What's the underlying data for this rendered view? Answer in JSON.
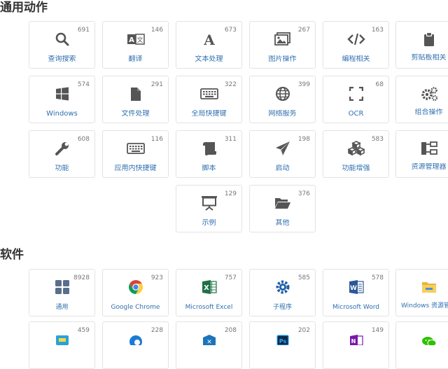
{
  "sections": [
    {
      "title": "通用动作",
      "cards": [
        {
          "label": "查询搜索",
          "count": "691",
          "icon": "search-icon"
        },
        {
          "label": "翻译",
          "count": "146",
          "icon": "translate-icon"
        },
        {
          "label": "文本处理",
          "count": "673",
          "icon": "font-icon"
        },
        {
          "label": "图片操作",
          "count": "267",
          "icon": "images-icon"
        },
        {
          "label": "编程相关",
          "count": "163",
          "icon": "code-icon"
        },
        {
          "label": "剪贴板相关",
          "count": "",
          "icon": "clipboard-icon"
        },
        {
          "label": "Windows",
          "count": "574",
          "icon": "windows-icon"
        },
        {
          "label": "文件处理",
          "count": "291",
          "icon": "file-icon"
        },
        {
          "label": "全局快捷键",
          "count": "322",
          "icon": "keyboard-icon"
        },
        {
          "label": "网络服务",
          "count": "399",
          "icon": "globe-icon"
        },
        {
          "label": "OCR",
          "count": "68",
          "icon": "scan-icon"
        },
        {
          "label": "组合操作",
          "count": "",
          "icon": "gears-icon"
        },
        {
          "label": "功能",
          "count": "608",
          "icon": "wrench-icon"
        },
        {
          "label": "应用内快捷键",
          "count": "116",
          "icon": "keyboard-icon"
        },
        {
          "label": "脚本",
          "count": "311",
          "icon": "scroll-icon"
        },
        {
          "label": "启动",
          "count": "198",
          "icon": "paper-plane-icon"
        },
        {
          "label": "功能增强",
          "count": "583",
          "icon": "cubes-icon"
        },
        {
          "label": "资源管理器",
          "count": "",
          "icon": "sitemap-icon"
        },
        {
          "label": "示例",
          "count": "129",
          "icon": "presentation-icon"
        },
        {
          "label": "其他",
          "count": "376",
          "icon": "folder-open-icon"
        }
      ]
    },
    {
      "title": "软件",
      "cards": [
        {
          "label": "通用",
          "count": "8928",
          "icon": "grid-icon"
        },
        {
          "label": "Google Chrome",
          "count": "923",
          "icon": "chrome-icon"
        },
        {
          "label": "Microsoft Excel",
          "count": "757",
          "icon": "excel-icon"
        },
        {
          "label": "子程序",
          "count": "585",
          "icon": "gear-icon"
        },
        {
          "label": "Microsoft Word",
          "count": "578",
          "icon": "word-icon"
        },
        {
          "label": "Windows 资源管理",
          "count": "",
          "icon": "explorer-icon"
        },
        {
          "label": "",
          "count": "459",
          "icon": "app-icon"
        },
        {
          "label": "",
          "count": "228",
          "icon": "edge-icon"
        },
        {
          "label": "",
          "count": "208",
          "icon": "vscode-icon"
        },
        {
          "label": "",
          "count": "202",
          "icon": "photoshop-icon"
        },
        {
          "label": "",
          "count": "149",
          "icon": "onenote-icon"
        },
        {
          "label": "",
          "count": "",
          "icon": "wechat-icon"
        }
      ]
    }
  ],
  "colors": {
    "label": "#2f6fb0",
    "icon": "#555555",
    "border": "#e3e3e3",
    "count": "#777777"
  }
}
